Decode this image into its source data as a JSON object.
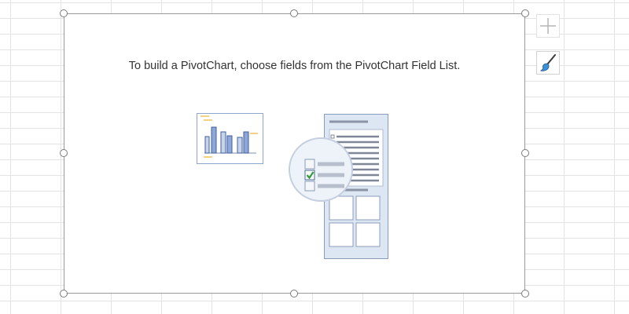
{
  "pivot_chart": {
    "placeholder_text": "To build a PivotChart, choose fields from the PivotChart Field List."
  },
  "side_buttons": {
    "add_icon": "plus-icon",
    "style_icon": "paintbrush-icon"
  },
  "colors": {
    "bar_fill": "#8ea7d6",
    "bar_stroke": "#3f5f9e",
    "accent_yellow": "#f0c35a",
    "check_green": "#2e9d3a",
    "panel_blue": "#dde6f3"
  }
}
